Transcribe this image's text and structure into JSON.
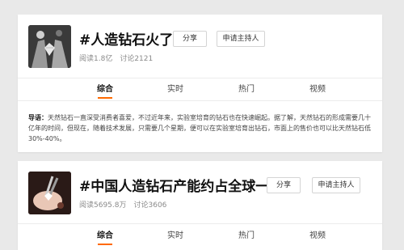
{
  "topics": [
    {
      "title": "#人造钻石火了#",
      "share_label": "分享",
      "host_label": "申请主持人",
      "reads": "阅读1.8亿",
      "discussions": "讨论2121",
      "tabs": [
        {
          "label": "综合",
          "active": true
        },
        {
          "label": "实时",
          "active": false
        },
        {
          "label": "热门",
          "active": false
        },
        {
          "label": "视频",
          "active": false
        }
      ],
      "intro_lead": "导语：",
      "intro_text": "天然钻石一直深受消费者喜爱，不过近年来，实验室培育的钻石也在快速崛起。据了解，天然钻石的形成需要几十亿年的时间，但现在，随着技术发展，只需要几个星期，便可以在实验室培育出钻石，市面上的售价也可以比天然钻石低30%-40%。",
      "thumbnail_icon": "hands-holding-diamond-photo"
    },
    {
      "title": "#中国人造钻石产能约占全球一半#",
      "share_label": "分享",
      "host_label": "申请主持人",
      "reads": "阅读5695.8万",
      "discussions": "讨论3606",
      "tabs": [
        {
          "label": "综合",
          "active": true
        },
        {
          "label": "实时",
          "active": false
        },
        {
          "label": "热门",
          "active": false
        },
        {
          "label": "视频",
          "active": false
        }
      ],
      "thumbnail_icon": "tweezers-diamond-photo"
    }
  ],
  "colors": {
    "accent": "#ff6a00",
    "page_bg": "#e9e9e9",
    "card_bg": "#ffffff",
    "muted_text": "#8a8a8a"
  }
}
